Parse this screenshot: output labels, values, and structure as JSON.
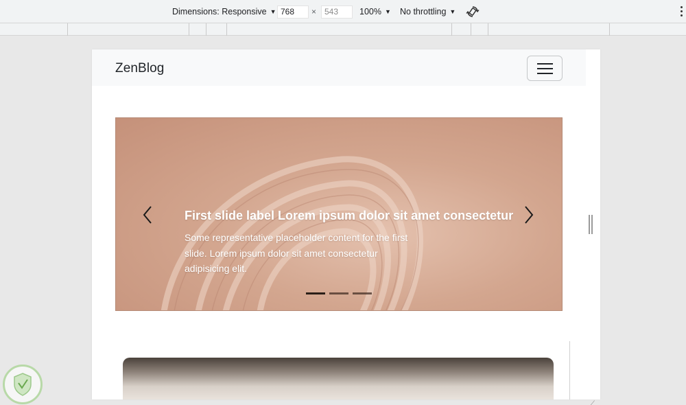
{
  "devtools": {
    "dimensions_label": "Dimensions: Responsive",
    "width_value": "768",
    "times_symbol": "×",
    "height_value": "543",
    "zoom": "100%",
    "throttling": "No throttling",
    "caret": "▼",
    "rotate_icon": "rotate-icon",
    "more_icon": "more-vertical-icon"
  },
  "navbar": {
    "brand": "ZenBlog",
    "toggler_icon": "hamburger-menu-icon"
  },
  "carousel": {
    "slide_title": "First slide label Lorem ipsum dolor sit amet consectetur",
    "slide_text": "Some representative placeholder content for the first slide. Lorem ipsum dolor sit amet consectetur adipisicing elit.",
    "prev_icon": "chevron-left-icon",
    "next_icon": "chevron-right-icon",
    "indicator_count": 3,
    "active_indicator": 0
  },
  "colors": {
    "slide_bg": "#d3a68f",
    "navbar_bg": "#f8f9fa",
    "devtools_bg": "#f1f3f4"
  }
}
